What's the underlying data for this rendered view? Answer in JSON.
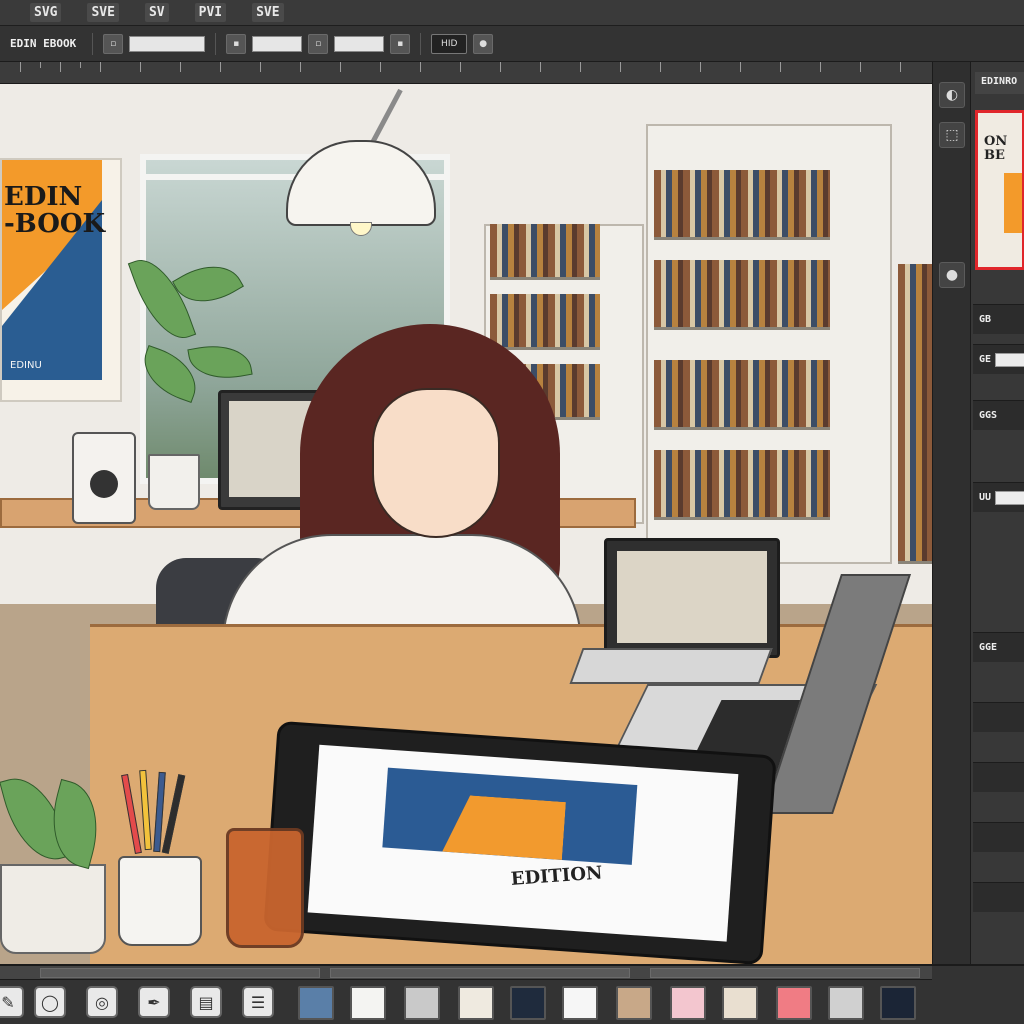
{
  "menubar": {
    "items": [
      {
        "id": "m1",
        "label": "SVG"
      },
      {
        "id": "m2",
        "label": "SVE"
      },
      {
        "id": "m3",
        "label": "SV"
      },
      {
        "id": "m4",
        "label": "PVI"
      },
      {
        "id": "m5",
        "label": "SVE"
      }
    ]
  },
  "optionsbar": {
    "document_name": "EDIN EBOOK",
    "mode_label": "HID"
  },
  "canvas": {
    "poster_title_line1": "EDIN",
    "poster_title_line2": "-BOOK",
    "poster_footer": "EDINU",
    "tablet_cover_text": "EDITION"
  },
  "rightpanel": {
    "header": "EDINRO",
    "thumbnail_text_line1": "ON",
    "thumbnail_text_line2": "BE",
    "properties": [
      {
        "label": "GB"
      },
      {
        "label": "GE"
      },
      {
        "label": "GGS"
      },
      {
        "label": "UU"
      },
      {
        "label": "GGE"
      }
    ]
  },
  "bottombar": {
    "tools": [
      {
        "icon": "brush-icon"
      },
      {
        "icon": "eraser-icon"
      },
      {
        "icon": "smudge-icon"
      },
      {
        "icon": "pen-icon"
      },
      {
        "icon": "layers-icon"
      },
      {
        "icon": "stack-icon"
      }
    ],
    "swatches": [
      {
        "name": "steel-blue",
        "color": "#5a7fa8"
      },
      {
        "name": "white",
        "color": "#f4f4f2"
      },
      {
        "name": "light-gray",
        "color": "#c9c9c9"
      },
      {
        "name": "cream",
        "color": "#efeae0"
      },
      {
        "name": "navy",
        "color": "#1f2b3d"
      },
      {
        "name": "off-white",
        "color": "#f6f6f6"
      },
      {
        "name": "tan",
        "color": "#c8a888"
      },
      {
        "name": "pink",
        "color": "#f3c6cf"
      },
      {
        "name": "beige",
        "color": "#e9dfd0"
      },
      {
        "name": "coral",
        "color": "#f07c84"
      },
      {
        "name": "silver",
        "color": "#d0d0d0"
      },
      {
        "name": "dark-navy",
        "color": "#1b2536"
      }
    ]
  }
}
